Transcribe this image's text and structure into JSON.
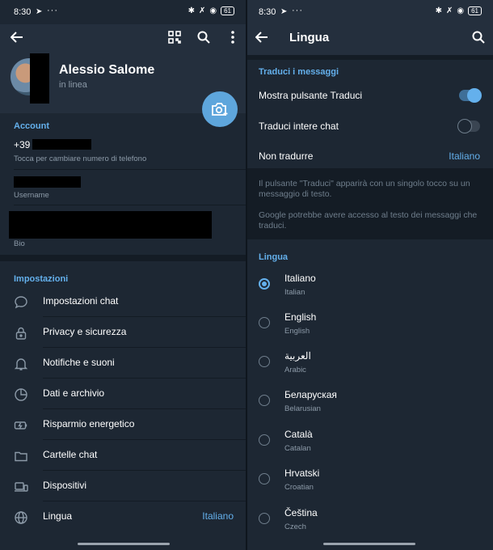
{
  "status_bar": {
    "time": "8:30",
    "battery": "61"
  },
  "left": {
    "profile": {
      "name": "Alessio Salome",
      "status": "in linea"
    },
    "account": {
      "title": "Account",
      "phone_prefix": "+39",
      "phone_hint": "Tocca per cambiare numero di telefono",
      "username_label": "Username",
      "bio_label": "Bio"
    },
    "settings": {
      "title": "Impostazioni",
      "items": [
        {
          "label": "Impostazioni chat",
          "icon": "chat-bubble-icon"
        },
        {
          "label": "Privacy e sicurezza",
          "icon": "lock-icon"
        },
        {
          "label": "Notifiche e suoni",
          "icon": "bell-icon"
        },
        {
          "label": "Dati e archivio",
          "icon": "pie-chart-icon"
        },
        {
          "label": "Risparmio energetico",
          "icon": "battery-icon"
        },
        {
          "label": "Cartelle chat",
          "icon": "folder-icon"
        },
        {
          "label": "Dispositivi",
          "icon": "devices-icon"
        },
        {
          "label": "Lingua",
          "icon": "globe-icon",
          "value": "Italiano"
        }
      ]
    }
  },
  "right": {
    "title": "Lingua",
    "translate": {
      "section_title": "Traduci i messaggi",
      "show_button_label": "Mostra pulsante Traduci",
      "show_button_on": true,
      "translate_chats_label": "Traduci intere chat",
      "translate_chats_on": false,
      "dont_translate_label": "Non tradurre",
      "dont_translate_value": "Italiano",
      "info_1": "Il pulsante \"Traduci\" apparirà con un singolo tocco su un messaggio di testo.",
      "info_2": "Google potrebbe avere accesso al testo dei messaggi che traduci."
    },
    "languages": {
      "section_title": "Lingua",
      "selected": 0,
      "items": [
        {
          "name": "Italiano",
          "english": "Italian"
        },
        {
          "name": "English",
          "english": "English"
        },
        {
          "name": "العربية",
          "english": "Arabic"
        },
        {
          "name": "Беларуская",
          "english": "Belarusian"
        },
        {
          "name": "Català",
          "english": "Catalan"
        },
        {
          "name": "Hrvatski",
          "english": "Croatian"
        },
        {
          "name": "Čeština",
          "english": "Czech"
        }
      ]
    }
  },
  "colors": {
    "accent": "#64b0ec",
    "background": "#1d2733",
    "header": "#242f3d"
  }
}
